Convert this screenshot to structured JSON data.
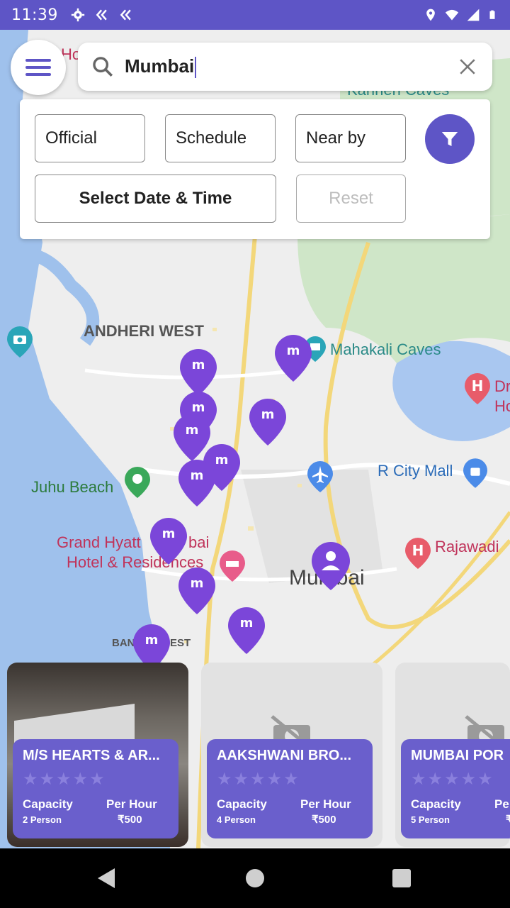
{
  "status_bar": {
    "time": "11:39",
    "left_icons": [
      "settings-icon",
      "double-chevron-icon",
      "double-chevron-icon"
    ],
    "right_icons": [
      "location-icon",
      "wifi-icon",
      "signal-icon",
      "battery-icon"
    ]
  },
  "search": {
    "value": "Mumbai",
    "menu_icon": "hamburger-icon",
    "search_icon": "search-icon",
    "clear_icon": "close-icon"
  },
  "filters": {
    "official": "Official",
    "schedule": "Schedule",
    "near_by": "Near by",
    "select_datetime": "Select Date & Time",
    "reset": "Reset",
    "filter_icon": "filter-icon"
  },
  "map_labels": {
    "andheri_west": "ANDHERI WEST",
    "mahakali_caves": "Mahakali Caves",
    "juhu_beach": "Juhu Beach",
    "r_city_mall": "R City Mall",
    "grand_hyatt_1": "Grand Hyatt",
    "grand_hyatt_bai": "bai",
    "grand_hyatt_2": "Hotel & Residences",
    "mumbai": "Mumbai",
    "rajawadi": "Rajawadi",
    "bandra_partial": "BAN",
    "bandra_partial2": "EST",
    "kanheri_caves": "Kanheri Caves",
    "dr_partial": "Dr",
    "ho_partial": "Ho",
    "ho_top_partial": "Ho",
    "marker_glyph": "m"
  },
  "colors": {
    "brand": "#5e55c6",
    "card": "#6a5fcc"
  },
  "cards": [
    {
      "name": "M/S HEARTS & AR...",
      "stars": "★★★★★",
      "capacity_label": "Capacity",
      "capacity": "2 Person",
      "price_label": "Per Hour",
      "price": "₹500"
    },
    {
      "name": "AAKSHWANI BRO...",
      "stars": "★★★★★",
      "capacity_label": "Capacity",
      "capacity": "4 Person",
      "price_label": "Per Hour",
      "price": "₹500"
    },
    {
      "name": "MUMBAI POR",
      "stars": "★★★★★",
      "capacity_label": "Capacity",
      "capacity": "5 Person",
      "price_label": "Pe",
      "price": "₹"
    }
  ]
}
